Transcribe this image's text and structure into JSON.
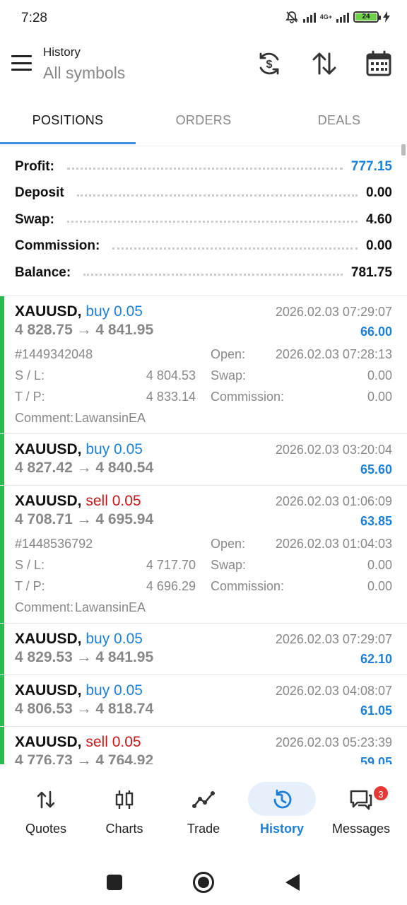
{
  "status": {
    "time": "7:28",
    "network": "4G+",
    "battery": "24"
  },
  "header": {
    "title": "History",
    "subtitle": "All symbols"
  },
  "tabs": [
    {
      "label": "POSITIONS",
      "active": true
    },
    {
      "label": "ORDERS",
      "active": false
    },
    {
      "label": "DEALS",
      "active": false
    }
  ],
  "summary": [
    {
      "label": "Profit:",
      "value": "777.15"
    },
    {
      "label": "Deposit",
      "value": "0.00"
    },
    {
      "label": "Swap:",
      "value": "4.60"
    },
    {
      "label": "Commission:",
      "value": "0.00"
    },
    {
      "label": "Balance:",
      "value": "781.75"
    }
  ],
  "labels": {
    "open": "Open:",
    "sl": "S / L:",
    "tp": "T / P:",
    "swap": "Swap:",
    "commission": "Commission:",
    "comment": "Comment:"
  },
  "deals": [
    {
      "symbol": "XAUUSD,",
      "direction": "buy 0.05",
      "type": "buy",
      "prices": "4 828.75 → 4 841.95",
      "time": "2026.02.03 07:29:07",
      "profit": "66.00",
      "expanded": true,
      "ticket": "#1449342048",
      "open": "2026.02.03 07:28:13",
      "sl": "4 804.53",
      "tp": "4 833.14",
      "swap": "0.00",
      "commission": "0.00",
      "comment": "LawansinEA"
    },
    {
      "symbol": "XAUUSD,",
      "direction": "buy 0.05",
      "type": "buy",
      "prices": "4 827.42 → 4 840.54",
      "time": "2026.02.03 03:20:04",
      "profit": "65.60",
      "expanded": false
    },
    {
      "symbol": "XAUUSD,",
      "direction": "sell 0.05",
      "type": "sell",
      "prices": "4 708.71 → 4 695.94",
      "time": "2026.02.03 01:06:09",
      "profit": "63.85",
      "expanded": true,
      "ticket": "#1448536792",
      "open": "2026.02.03 01:04:03",
      "sl": "4 717.70",
      "tp": "4 696.29",
      "swap": "0.00",
      "commission": "0.00",
      "comment": "LawansinEA"
    },
    {
      "symbol": "XAUUSD,",
      "direction": "buy 0.05",
      "type": "buy",
      "prices": "4 829.53 → 4 841.95",
      "time": "2026.02.03 07:29:07",
      "profit": "62.10",
      "expanded": false
    },
    {
      "symbol": "XAUUSD,",
      "direction": "buy 0.05",
      "type": "buy",
      "prices": "4 806.53 → 4 818.74",
      "time": "2026.02.03 04:08:07",
      "profit": "61.05",
      "expanded": false
    },
    {
      "symbol": "XAUUSD,",
      "direction": "sell 0.05",
      "type": "sell",
      "prices": "4 776.73 → 4 764.92",
      "time": "2026.02.03 05:23:39",
      "profit": "59.05",
      "expanded": false
    }
  ],
  "nav": [
    {
      "label": "Quotes",
      "icon": "quotes-icon"
    },
    {
      "label": "Charts",
      "icon": "charts-icon"
    },
    {
      "label": "Trade",
      "icon": "trade-icon"
    },
    {
      "label": "History",
      "icon": "history-icon",
      "active": true
    },
    {
      "label": "Messages",
      "icon": "messages-icon",
      "badge": "3"
    }
  ],
  "colors": {
    "accent": "#1e7fd6",
    "sell": "#c41a1a",
    "position_bar": "#2fb84f",
    "badge": "#e53935"
  }
}
